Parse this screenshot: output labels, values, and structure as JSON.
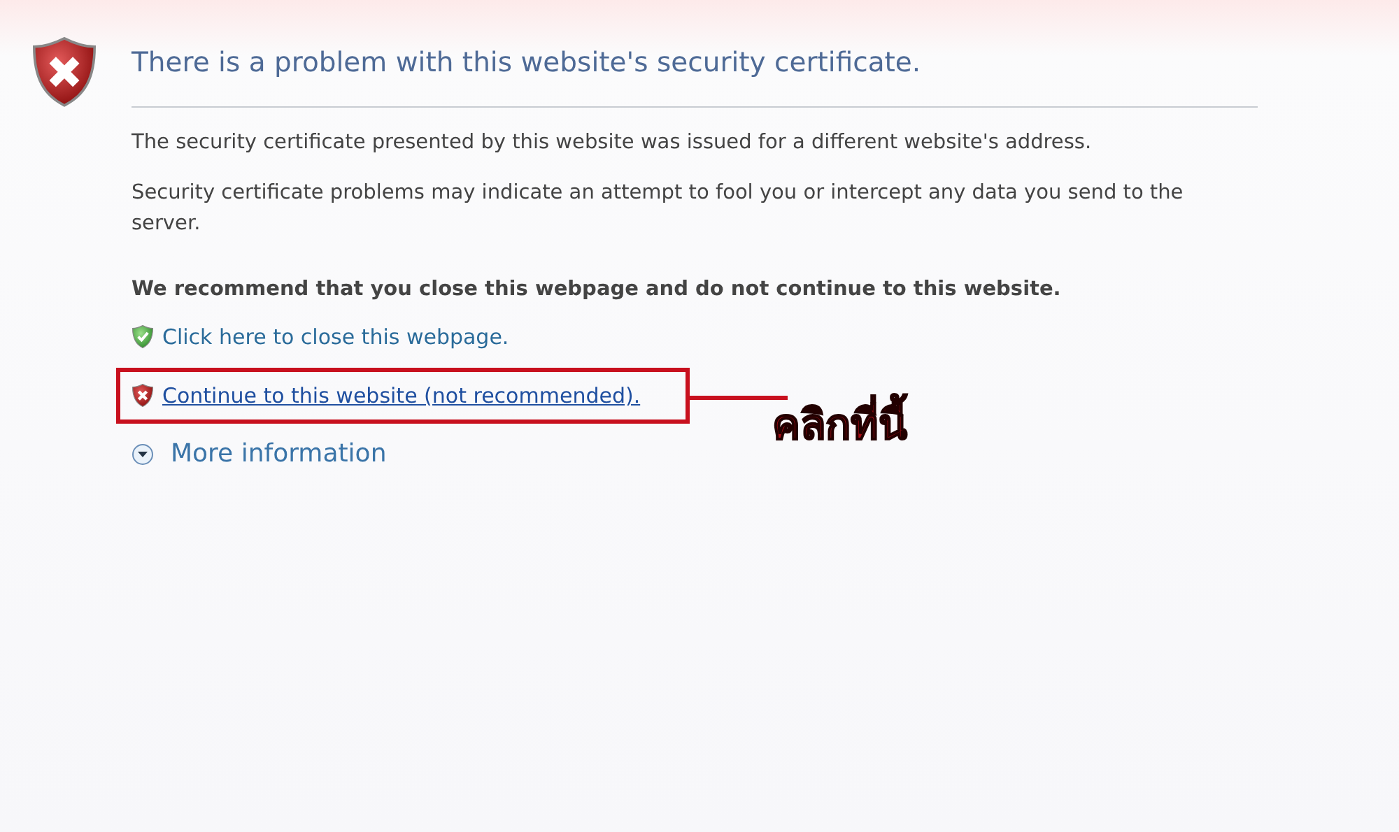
{
  "title": "There is a problem with this website's security certificate.",
  "paragraphs": [
    "The security certificate presented by this website was issued for a different website's address.",
    "Security certificate problems may indicate an attempt to fool you or intercept any data you send to the server."
  ],
  "recommendation": "We recommend that you close this webpage and do not continue to this website.",
  "links": [
    {
      "kind": "safe",
      "label": "Click here to close this webpage.",
      "underlined": false,
      "highlighted": false
    },
    {
      "kind": "unsafe",
      "label": "Continue to this website (not recommended).",
      "underlined": true,
      "highlighted": true
    }
  ],
  "more_info": {
    "label": "More information",
    "expanded": false
  },
  "annotation": {
    "label": "คลิกที่นี้"
  }
}
